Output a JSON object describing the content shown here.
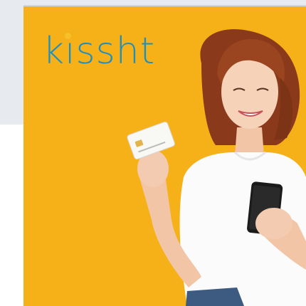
{
  "brand": {
    "name": "kissht",
    "logo_color": "#1f8fbf",
    "dot_color": "#f6c02b"
  },
  "colors": {
    "page_bg": "#e7ebef",
    "card_bg": "#f6b119"
  },
  "image": {
    "subject": "woman-holding-credit-card-and-smartphone"
  }
}
